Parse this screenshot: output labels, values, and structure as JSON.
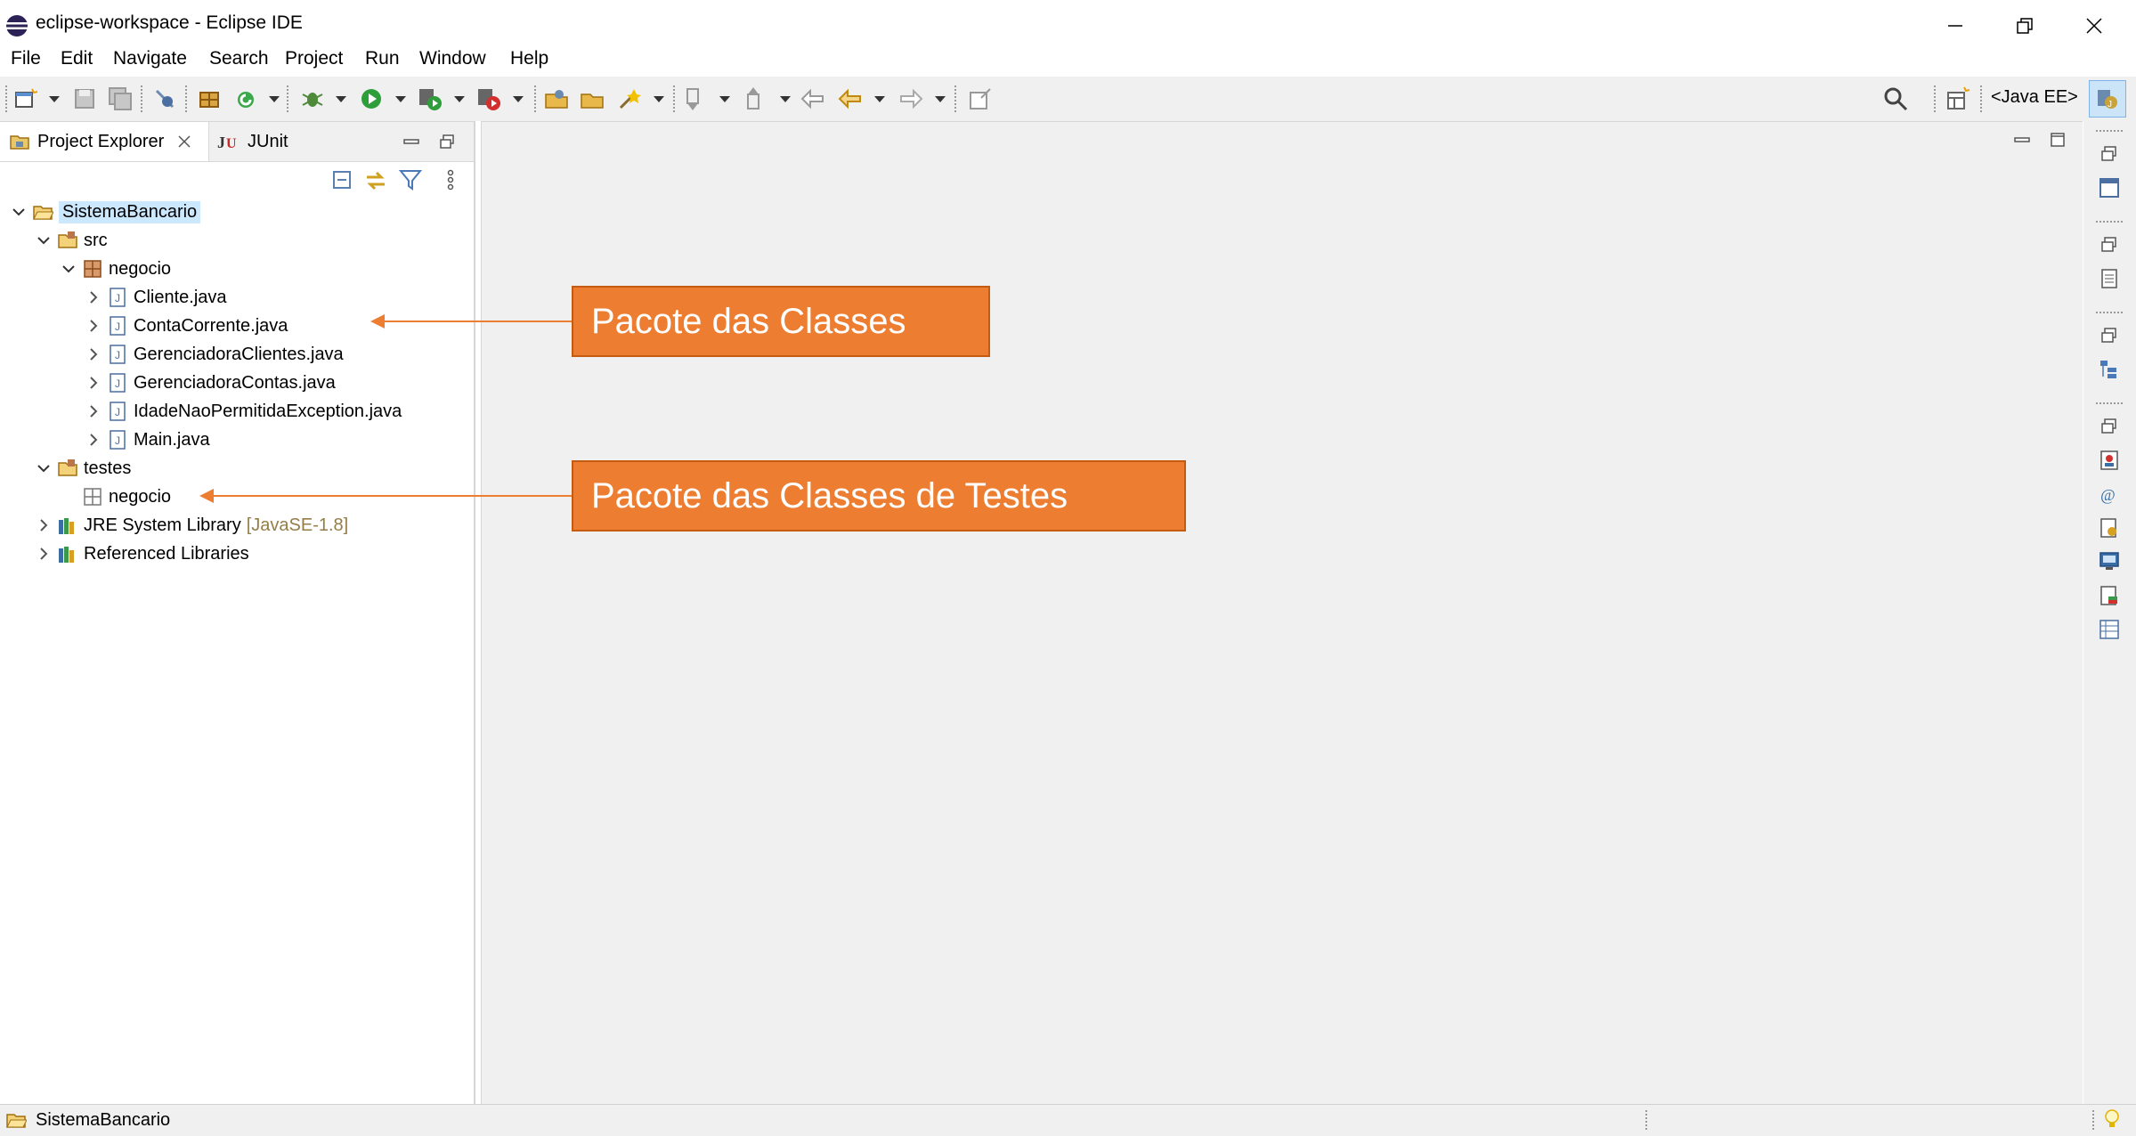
{
  "window": {
    "title": "eclipse-workspace - Eclipse IDE",
    "controls": {
      "minimize": "minimize-icon",
      "restore": "restore-icon",
      "close": "close-icon"
    }
  },
  "menu": [
    "File",
    "Edit",
    "Navigate",
    "Search",
    "Project",
    "Run",
    "Window",
    "Help"
  ],
  "toolbar": {
    "perspective_label": "<Java EE>"
  },
  "left_panel": {
    "tabs": [
      {
        "label": "Project Explorer",
        "icon": "project-explorer-icon",
        "active": true
      },
      {
        "label": "JUnit",
        "icon": "junit-icon",
        "active": false
      }
    ],
    "tree": [
      {
        "label": "SistemaBancario",
        "level": 0,
        "type": "project",
        "expanded": true,
        "selected": true
      },
      {
        "label": "src",
        "level": 1,
        "type": "source-folder",
        "expanded": true
      },
      {
        "label": "negocio",
        "level": 2,
        "type": "package",
        "expanded": true
      },
      {
        "label": "Cliente.java",
        "level": 3,
        "type": "java-file",
        "expanded": false
      },
      {
        "label": "ContaCorrente.java",
        "level": 3,
        "type": "java-file",
        "expanded": false
      },
      {
        "label": "GerenciadoraClientes.java",
        "level": 3,
        "type": "java-file",
        "expanded": false
      },
      {
        "label": "GerenciadoraContas.java",
        "level": 3,
        "type": "java-file",
        "expanded": false
      },
      {
        "label": "IdadeNaoPermitidaException.java",
        "level": 3,
        "type": "java-file",
        "expanded": false
      },
      {
        "label": "Main.java",
        "level": 3,
        "type": "java-file",
        "expanded": false
      },
      {
        "label": "testes",
        "level": 1,
        "type": "source-folder",
        "expanded": true
      },
      {
        "label": "negocio",
        "level": 2,
        "type": "empty-package",
        "expanded": null
      },
      {
        "label": "JRE System Library",
        "suffix": "[JavaSE-1.8]",
        "level": 1,
        "type": "library",
        "expanded": false
      },
      {
        "label": "Referenced Libraries",
        "level": 1,
        "type": "library",
        "expanded": false
      }
    ]
  },
  "annotations": {
    "classes": "Pacote das Classes",
    "tests": "Pacote das Classes de Testes"
  },
  "status": {
    "selected_item": "SistemaBancario"
  },
  "colors": {
    "callout_fill": "#ed7d31",
    "selection": "#cce8ff",
    "toolbar_bg": "#f0f0f0"
  }
}
